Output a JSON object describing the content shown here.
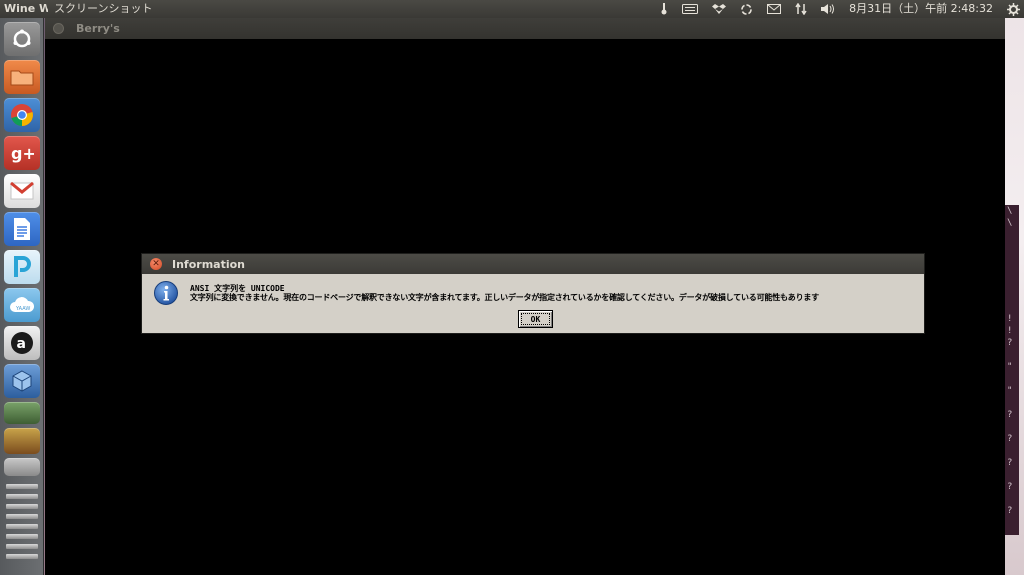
{
  "panel": {
    "app_name": "Wine W",
    "window_title": "スクリーンショット",
    "datetime": "8月31日（土）午前 2:48:32"
  },
  "launcher": {
    "items": [
      {
        "name": "dash",
        "icon": "ubuntu-logo-icon",
        "color": "#8a8a8a"
      },
      {
        "name": "files",
        "icon": "folder-icon",
        "color": "#e2743a"
      },
      {
        "name": "chrome",
        "icon": "chrome-icon",
        "color": "#3d7cc9"
      },
      {
        "name": "google-plus",
        "icon": "google-plus-icon",
        "color": "#d73d32"
      },
      {
        "name": "gmail",
        "icon": "gmail-icon",
        "color": "#2f5fa8"
      },
      {
        "name": "docs",
        "icon": "docs-icon",
        "color": "#3f7be0"
      },
      {
        "name": "pandora",
        "icon": "pandora-icon",
        "color": "#2aa4d6"
      },
      {
        "name": "yaaw",
        "icon": "cloud-icon",
        "color": "#5fb2e0"
      },
      {
        "name": "amazon",
        "icon": "amazon-icon",
        "color": "#1b1b1b"
      },
      {
        "name": "virtualbox",
        "icon": "virtualbox-icon",
        "color": "#2c5e9e"
      }
    ]
  },
  "main_window": {
    "title": "Berry's"
  },
  "dialog": {
    "title": "Information",
    "line1": "ANSI 文字列を UNICODE",
    "line2": "文字列に変換できません。現在のコードページで解釈できない文字が含まれてます。正しいデータが指定されているかを確認してください。データが破損している可能性もあります",
    "ok_label": "OK"
  },
  "right_strip_text": "\\\n\\\n\n\n\n\n\n\n\n!\n!\n?\n\n\"\n\n\"\n\n?\n\n?\n\n?\n\n?\n\n?"
}
